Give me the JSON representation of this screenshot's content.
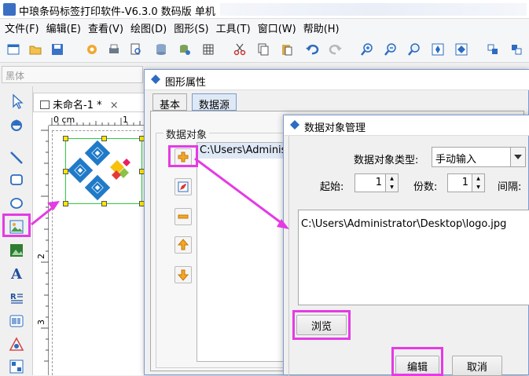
{
  "window": {
    "title": "中琅条码标签打印软件-V6.3.0 数码版 单机"
  },
  "menu": [
    "文件(F)",
    "编辑(E)",
    "查看(V)",
    "绘图(D)",
    "图形(S)",
    "工具(T)",
    "窗口(W)",
    "帮助(H)"
  ],
  "fontbar": {
    "font_name": "黑体"
  },
  "document": {
    "tab": "未命名-1 *",
    "close": "×",
    "ruler_unit": "0 cm",
    "ruler_top_1": "1",
    "ruler_left_2": "2",
    "ruler_left_3": "3"
  },
  "graphic_props": {
    "title": "图形属性",
    "tabs": [
      "基本",
      "数据源"
    ],
    "section_label": "数据对象",
    "list_items": [
      "C:\\Users\\Administrator\\Desktop\\logo.jpg"
    ]
  },
  "data_obj_mgr": {
    "title": "数据对象管理",
    "type_label": "数据对象类型:",
    "type_value": "手动输入",
    "start_label": "起始:",
    "start_value": "1",
    "copies_label": "份数:",
    "copies_value": "1",
    "interval_label": "间隔:",
    "path_value": "C:\\Users\\Administrator\\Desktop\\logo.jpg",
    "browse_label": "浏览",
    "edit_label": "编辑",
    "cancel_label": "取消"
  },
  "colors": {
    "highlight": "#e43be4",
    "logo_blue": "#1f7ac8",
    "selection": "#2ecc40"
  }
}
